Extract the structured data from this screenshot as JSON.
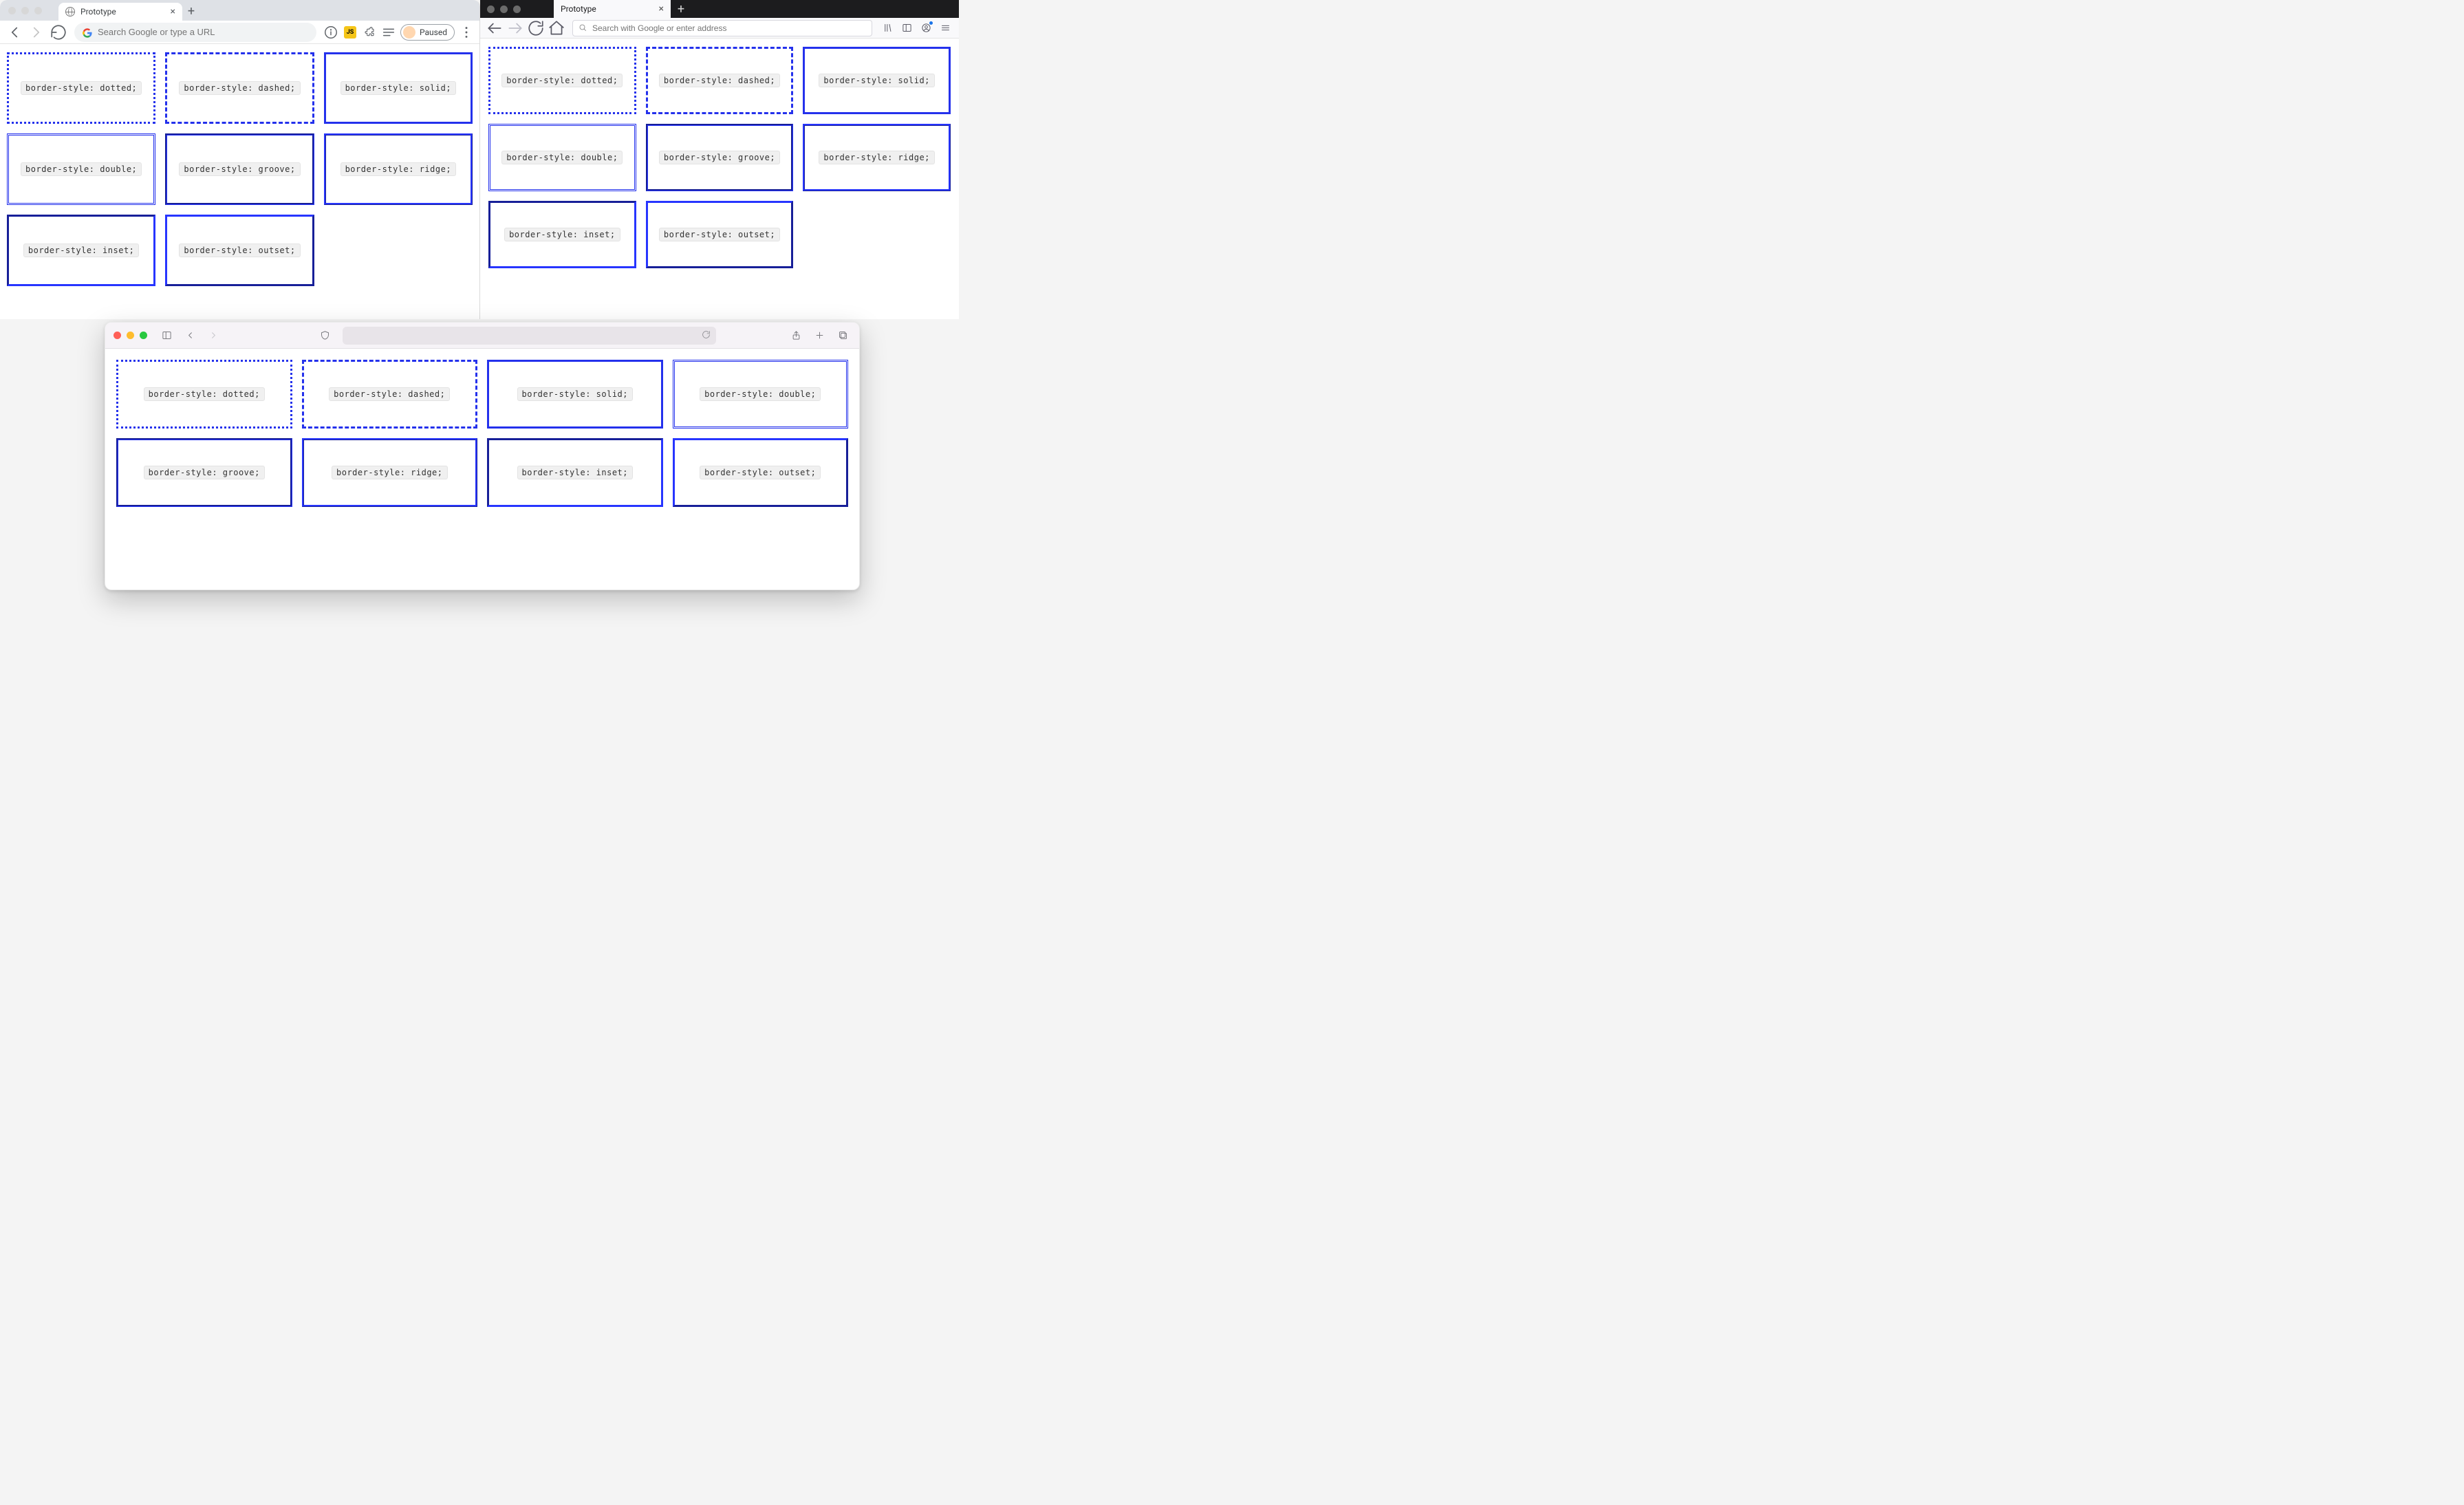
{
  "border_color": "#2431ec",
  "chrome": {
    "tab_title": "Prototype",
    "omnibox_placeholder": "Search Google or type a URL",
    "profile_label": "Paused",
    "swatches": [
      {
        "style": "dotted",
        "label": "border-style: dotted;"
      },
      {
        "style": "dashed",
        "label": "border-style: dashed;"
      },
      {
        "style": "solid",
        "label": "border-style: solid;"
      },
      {
        "style": "double",
        "label": "border-style: double;"
      },
      {
        "style": "groove",
        "label": "border-style: groove;"
      },
      {
        "style": "ridge",
        "label": "border-style: ridge;"
      },
      {
        "style": "inset",
        "label": "border-style: inset;"
      },
      {
        "style": "outset",
        "label": "border-style: outset;"
      }
    ]
  },
  "firefox": {
    "tab_title": "Prototype",
    "omnibox_placeholder": "Search with Google or enter address",
    "swatches": [
      {
        "style": "dotted",
        "label": "border-style: dotted;"
      },
      {
        "style": "dashed",
        "label": "border-style: dashed;"
      },
      {
        "style": "solid",
        "label": "border-style: solid;"
      },
      {
        "style": "double",
        "label": "border-style: double;"
      },
      {
        "style": "groove",
        "label": "border-style: groove;"
      },
      {
        "style": "ridge",
        "label": "border-style: ridge;"
      },
      {
        "style": "inset",
        "label": "border-style: inset;"
      },
      {
        "style": "outset",
        "label": "border-style: outset;"
      }
    ]
  },
  "safari": {
    "swatches": [
      {
        "style": "dotted",
        "label": "border-style: dotted;"
      },
      {
        "style": "dashed",
        "label": "border-style: dashed;"
      },
      {
        "style": "solid",
        "label": "border-style: solid;"
      },
      {
        "style": "double",
        "label": "border-style: double;"
      },
      {
        "style": "groove",
        "label": "border-style: groove;"
      },
      {
        "style": "ridge",
        "label": "border-style: ridge;"
      },
      {
        "style": "inset",
        "label": "border-style: inset;"
      },
      {
        "style": "outset",
        "label": "border-style: outset;"
      }
    ]
  }
}
